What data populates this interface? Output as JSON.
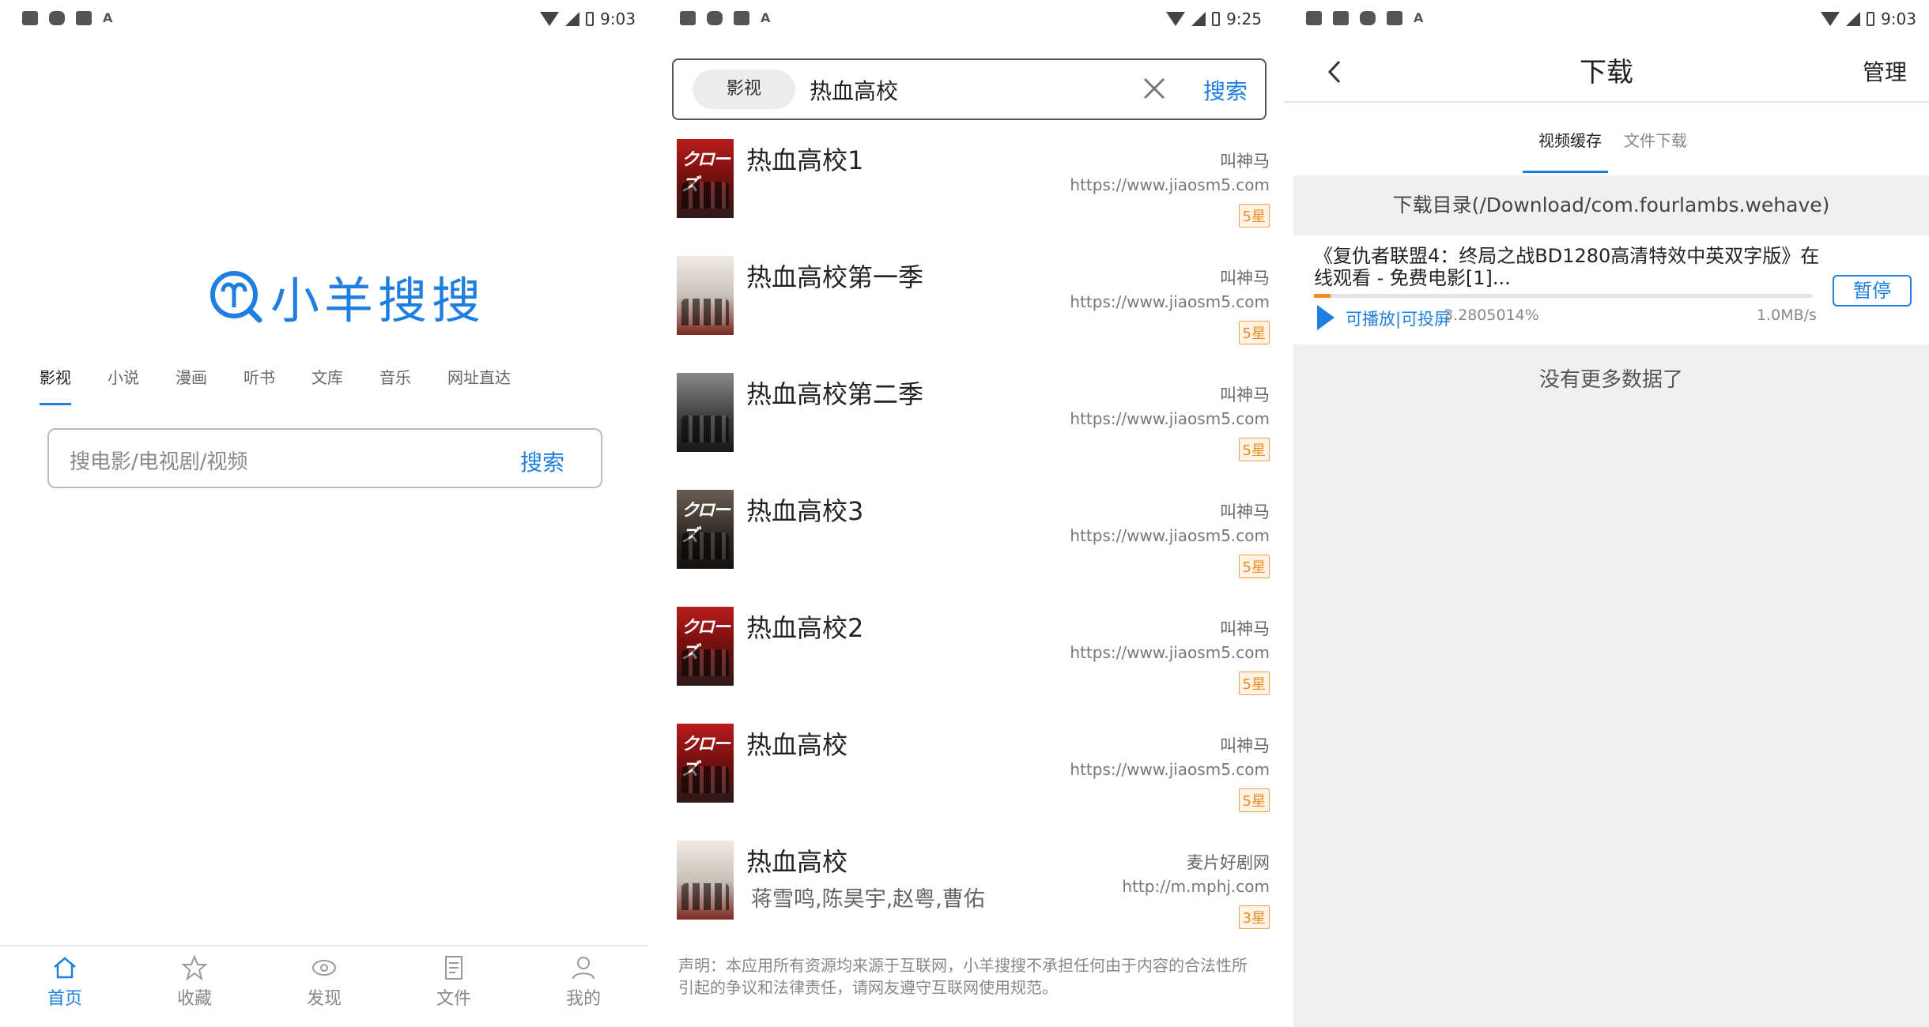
{
  "colors": {
    "accent": "#1e7fe0",
    "star": "#f08a24",
    "progress": "#f08a24"
  },
  "panel1": {
    "status": {
      "time": "9:03",
      "icons": [
        "image-icon",
        "image-icon",
        "square-icon",
        "box-x-icon",
        "a-icon"
      ]
    },
    "logo_text": "小羊搜搜",
    "categories": [
      "影视",
      "小说",
      "漫画",
      "听书",
      "文库",
      "音乐",
      "网址直达"
    ],
    "active_category": "影视",
    "search": {
      "placeholder": "搜电影/电视剧/视频",
      "button": "搜索"
    },
    "bottom_nav": [
      {
        "label": "首页",
        "icon": "home-icon",
        "active": true
      },
      {
        "label": "收藏",
        "icon": "star-icon",
        "active": false
      },
      {
        "label": "发现",
        "icon": "eye-icon",
        "active": false
      },
      {
        "label": "文件",
        "icon": "file-icon",
        "active": false
      },
      {
        "label": "我的",
        "icon": "user-icon",
        "active": false
      }
    ]
  },
  "panel2": {
    "status": {
      "time": "9:25"
    },
    "search": {
      "scope": "影视",
      "query": "热血高校",
      "button": "搜索"
    },
    "results": [
      {
        "title": "热血高校1",
        "subtitle": "",
        "source": "叫神马",
        "url": "https://www.jiaosm5.com",
        "rating": "5星",
        "poster": "red"
      },
      {
        "title": "热血高校第一季",
        "subtitle": "",
        "source": "叫神马",
        "url": "https://www.jiaosm5.com",
        "rating": "5星",
        "poster": "white"
      },
      {
        "title": "热血高校第二季",
        "subtitle": "",
        "source": "叫神马",
        "url": "https://www.jiaosm5.com",
        "rating": "5星",
        "poster": "dark"
      },
      {
        "title": "热血高校3",
        "subtitle": "",
        "source": "叫神马",
        "url": "https://www.jiaosm5.com",
        "rating": "5星",
        "poster": "brown"
      },
      {
        "title": "热血高校2",
        "subtitle": "",
        "source": "叫神马",
        "url": "https://www.jiaosm5.com",
        "rating": "5星",
        "poster": "red"
      },
      {
        "title": "热血高校",
        "subtitle": "",
        "source": "叫神马",
        "url": "https://www.jiaosm5.com",
        "rating": "5星",
        "poster": "red"
      },
      {
        "title": "热血高校",
        "subtitle": "蒋雪鸣,陈昊宇,赵粤,曹佑",
        "source": "麦片好剧网",
        "url": "http://m.mphj.com",
        "rating": "3星",
        "poster": "white"
      }
    ],
    "disclaimer": "声明：本应用所有资源均来源于互联网，小羊搜搜不承担任何由于内容的合法性所引起的争议和法律责任，请网友遵守互联网使用规范。"
  },
  "panel3": {
    "status": {
      "time": "9:03"
    },
    "header": {
      "title": "下载",
      "manage": "管理"
    },
    "tabs": [
      "视频缓存",
      "文件下载"
    ],
    "active_tab": "视频缓存",
    "directory": "下载目录(/Download/com.fourlambs.wehave)",
    "download": {
      "name": "《复仇者联盟4：终局之战BD1280高清特效中英双字版》在线观看 - 免费电影[1]...",
      "play_label": "可播放|可投屏",
      "percent": "3.2805014%",
      "progress": 0.0328,
      "speed": "1.0MB/s",
      "pause": "暂停"
    },
    "no_more": "没有更多数据了"
  }
}
